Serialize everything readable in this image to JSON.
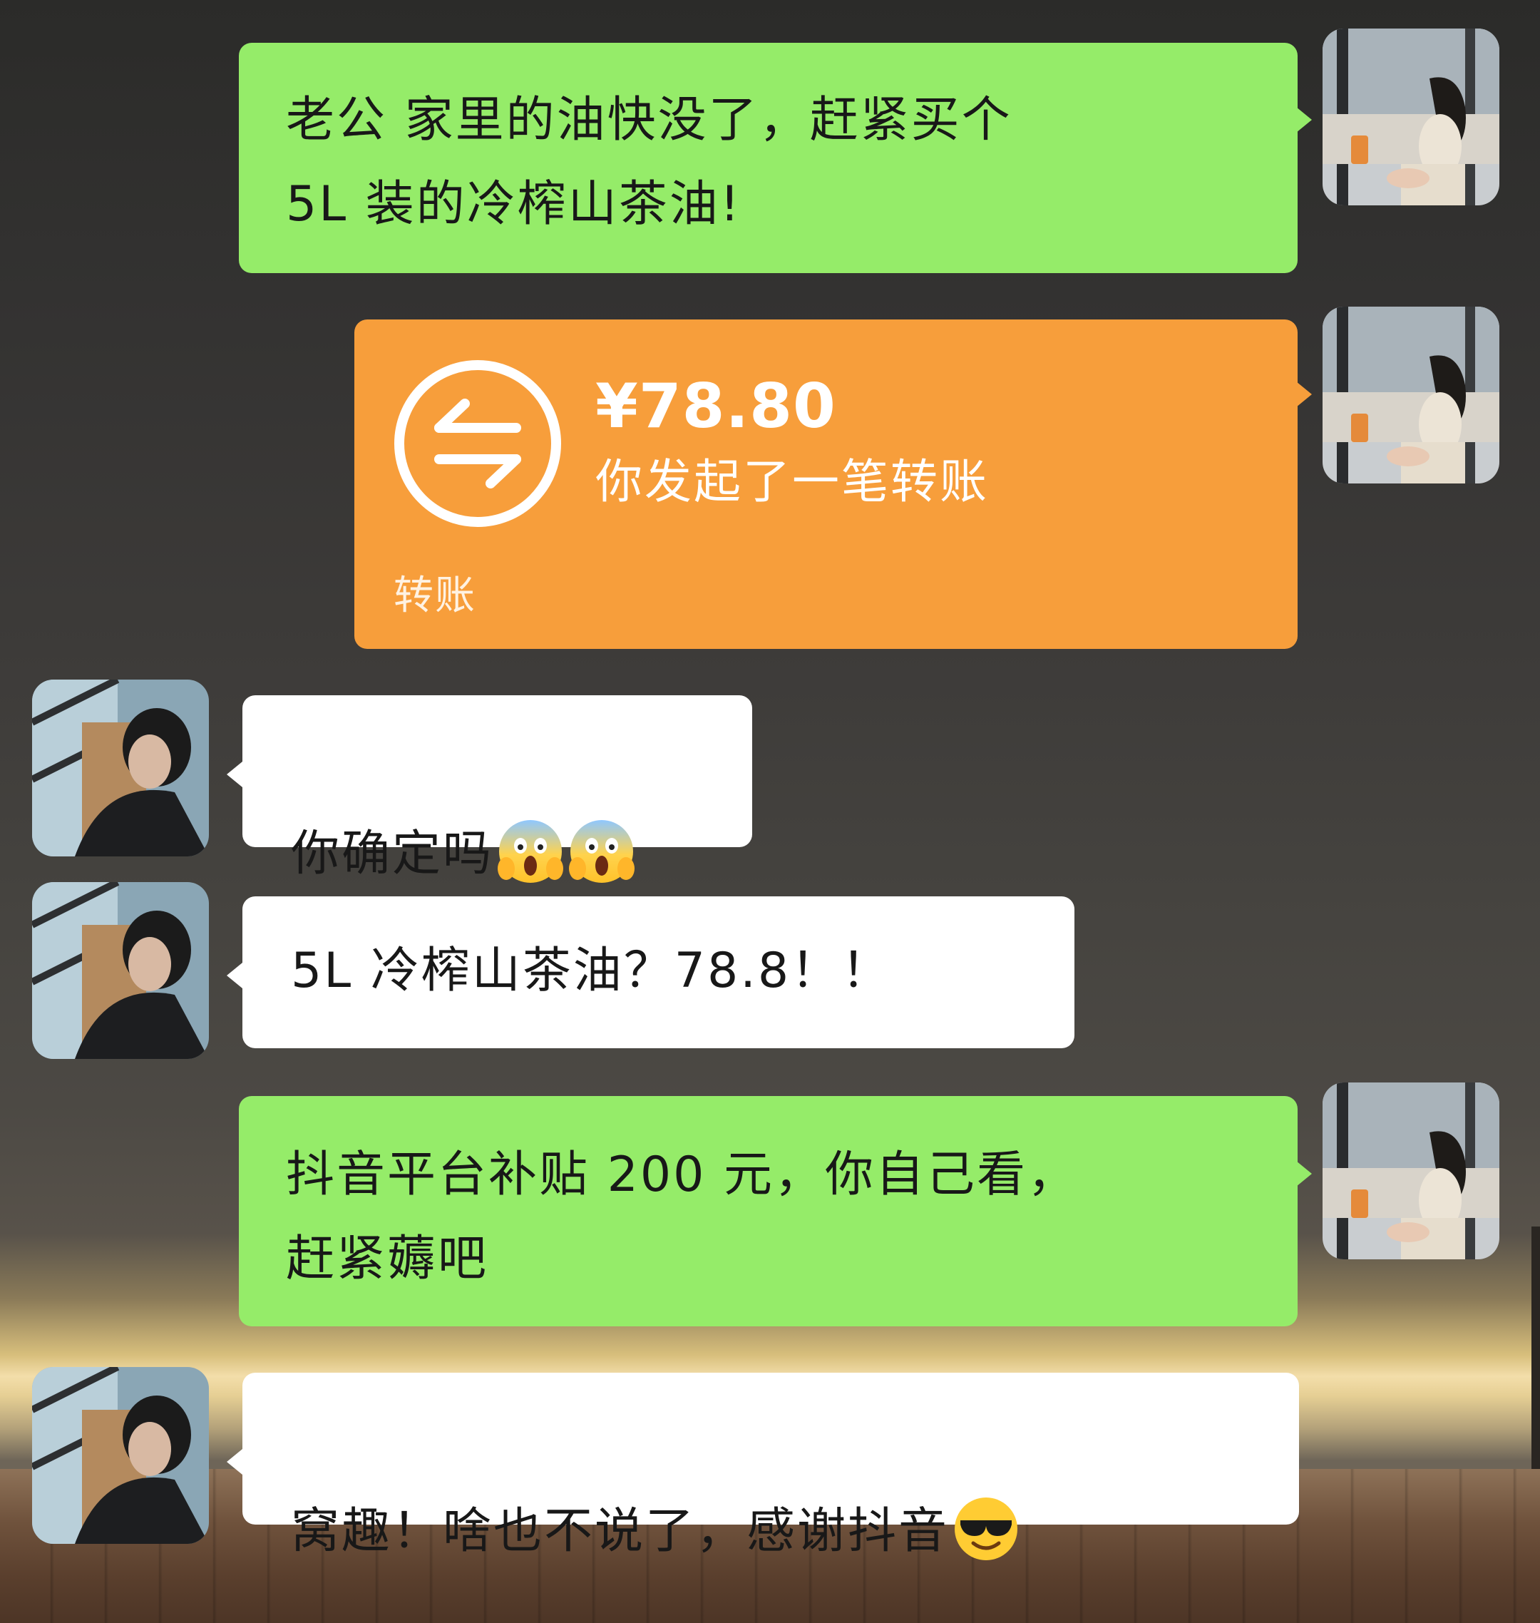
{
  "messages": [
    {
      "id": "m1",
      "side": "right",
      "type": "text",
      "text": "老公 家里的油快没了，赶紧买个\n5L 装的冷榨山茶油!"
    },
    {
      "id": "m2",
      "side": "right",
      "type": "transfer",
      "amount": "¥78.80",
      "description": "你发起了一笔转账",
      "footer": "转账"
    },
    {
      "id": "m3",
      "side": "left",
      "type": "text",
      "text": "你确定吗",
      "emoji": [
        "face-screaming-in-fear",
        "face-screaming-in-fear"
      ]
    },
    {
      "id": "m4",
      "side": "left",
      "type": "text",
      "text": "5L 冷榨山茶油？78.8！！"
    },
    {
      "id": "m5",
      "side": "right",
      "type": "text",
      "text": "抖音平台补贴 200 元，你自己看，\n赶紧薅吧"
    },
    {
      "id": "m6",
      "side": "left",
      "type": "text",
      "text": "窝趣！啥也不说了，感谢抖音",
      "emoji": [
        "smiling-face-with-sunglasses"
      ]
    }
  ],
  "colors": {
    "sent_bubble": "#95ec69",
    "received_bubble": "#ffffff",
    "transfer_bubble": "#f79e3b"
  },
  "icons": {
    "transfer": "transfer-arrows-icon",
    "self_avatar": "avatar-woman-photo",
    "other_avatar": "avatar-man-photo"
  }
}
